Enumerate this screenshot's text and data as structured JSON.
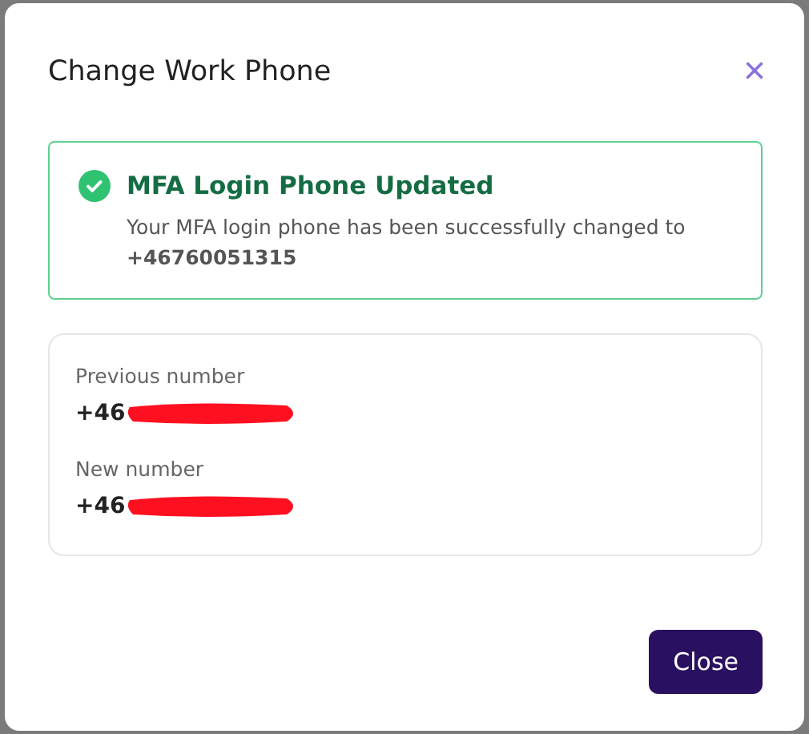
{
  "dialog": {
    "title": "Change Work Phone",
    "close_icon": "×"
  },
  "alert": {
    "kind": "success",
    "title": "MFA Login Phone Updated",
    "message": "Your MFA login phone has been successfully changed to",
    "number": "+46760051315"
  },
  "numbers": [
    {
      "label": "Previous number",
      "value": "+46",
      "redacted": true
    },
    {
      "label": "New number",
      "value": "+46",
      "redacted": true
    }
  ],
  "buttons": [
    {
      "label": "Close"
    }
  ]
}
